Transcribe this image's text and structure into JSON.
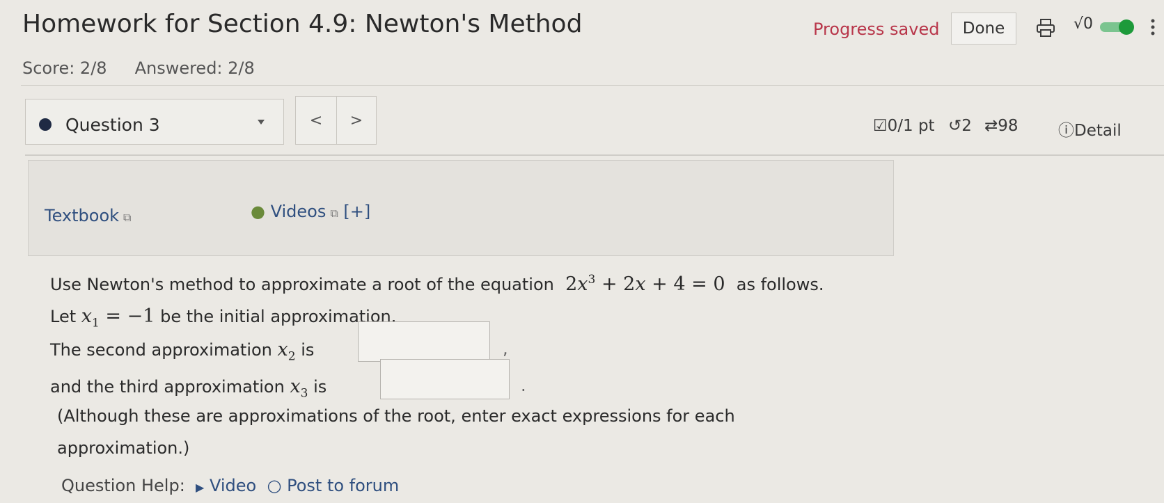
{
  "header": {
    "title": "Homework for Section 4.9: Newton's Method",
    "progress": "Progress saved",
    "done_label": "Done",
    "sqrt_label": "√0"
  },
  "score": {
    "score": "Score: 2/8",
    "answered": "Answered: 2/8"
  },
  "question_nav": {
    "label": "Question 3",
    "prev": "<",
    "next": ">",
    "points": "0/1 pt",
    "retries": "2",
    "attempts": "98",
    "details": "Detail"
  },
  "resources": {
    "textbook": "Textbook",
    "videos": "Videos",
    "expand": "[+]"
  },
  "question": {
    "intro_pre": "Use Newton's method to approximate a root of the equation",
    "intro_post": "as follows.",
    "let_pre": "Let",
    "let_post": "be the initial approximation.",
    "second_pre": "The second approximation",
    "second_is": "is",
    "second_post": ",",
    "third_pre": "and the third approximation",
    "third_is": "is",
    "third_post": ".",
    "note_line1": "(Although these are approximations of the root, enter exact expressions for each",
    "note_line2": "approximation.)",
    "x2_value": "",
    "x3_value": ""
  },
  "help": {
    "label": "Question Help:",
    "video": "Video",
    "forum": "Post to forum"
  },
  "colors": {
    "progress": "#b8364a",
    "link": "#2f4f7f",
    "toggle_green": "#1d9a3a"
  }
}
